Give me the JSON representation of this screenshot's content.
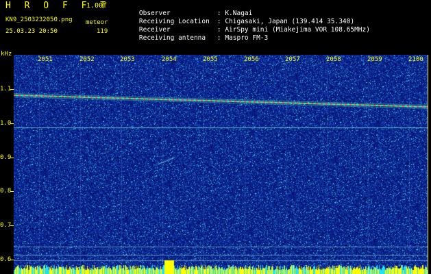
{
  "header": {
    "app_title": "H R O F F T",
    "version": "1.00f",
    "filename": "KN9_2503232050.png",
    "mode": "meteor",
    "datetime": "25.03.23 20:50",
    "count": "119",
    "observer_label": "Observer",
    "observer_value": ": K.Nagai",
    "location_label": "Receiving Location",
    "location_value": ": Chigasaki, Japan (139.414 35.340)",
    "receiver_label": "Receiver",
    "receiver_value": ": AirSpy mini (Miakejima VOR 108.65MHz)",
    "antenna_label": "Receiving antenna",
    "antenna_value": ": Maspro FM-3"
  },
  "axis": {
    "unit": "kHz",
    "y_labels": [
      "1.1",
      "1.0",
      "0.9",
      "0.8",
      "0.7",
      "0.6"
    ],
    "time_labels": [
      "2051",
      "2052",
      "2053",
      "2054",
      "2055",
      "2056",
      "2057",
      "2058",
      "2059",
      "2100"
    ]
  },
  "colors": {
    "background": "#000000",
    "label": "#ffff00",
    "spectrogram_base": "#0a1e8c",
    "noise_bright": "#2fd6e6",
    "signal_trace": "#ff8040"
  }
}
